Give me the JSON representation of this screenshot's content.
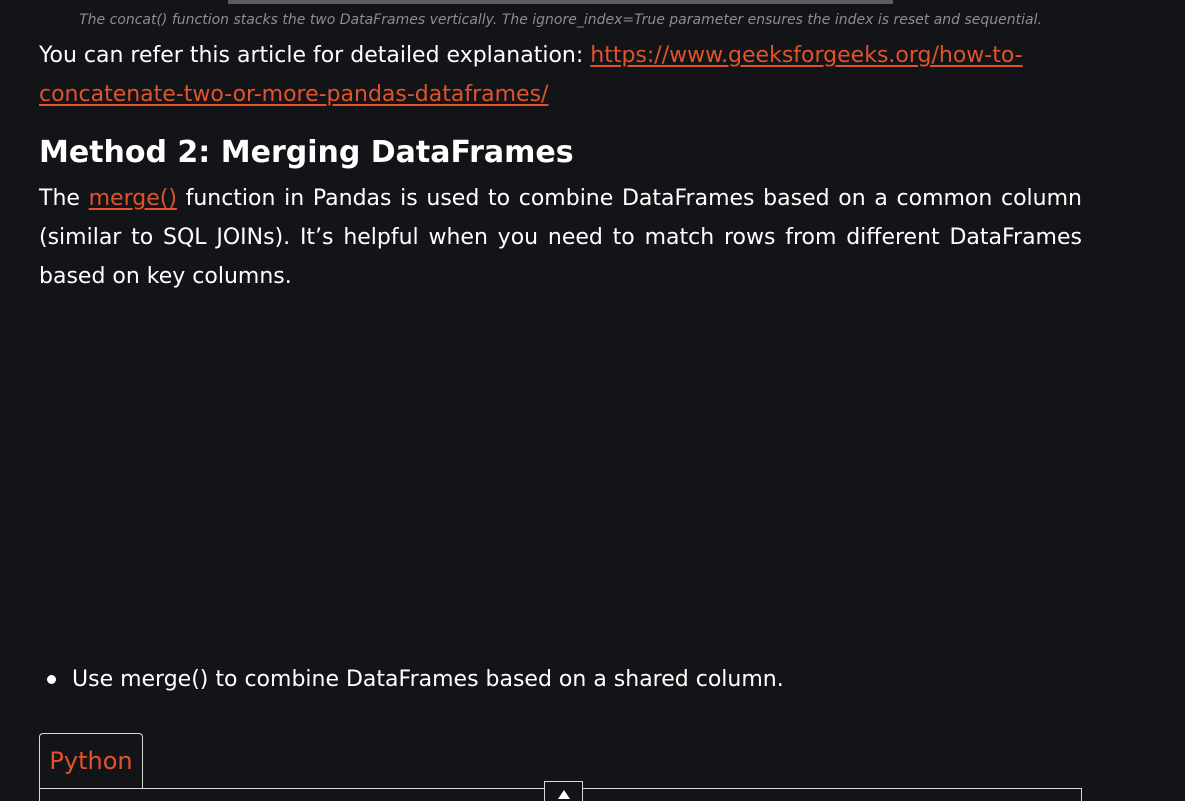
{
  "caption": "The concat() function stacks the two DataFrames vertically. The ignore_index=True parameter ensures the index is reset and sequential.",
  "refer": {
    "text": "You can refer this article for detailed explanation: ",
    "link": "https://www.geeksforgeeks.org/how-to-concatenate-two-or-more-pandas-dataframes/"
  },
  "section": {
    "heading": "Method 2: Merging DataFrames",
    "intro_before": "The ",
    "intro_link": "merge()",
    "intro_after": " function in Pandas is used to combine DataFrames based on a common column (similar to SQL JOINs). It’s helpful when you need to match rows from different DataFrames based on key columns."
  },
  "bullets": [
    "Use merge() to combine DataFrames based on a shared column."
  ],
  "code_tab": {
    "label": "Python"
  },
  "colors": {
    "background": "#131417",
    "link": "#e1532a",
    "caption": "#8a8d93"
  },
  "icons": {
    "scroll_top": "arrow-up-icon",
    "bullet": "bullet-dot-icon"
  }
}
